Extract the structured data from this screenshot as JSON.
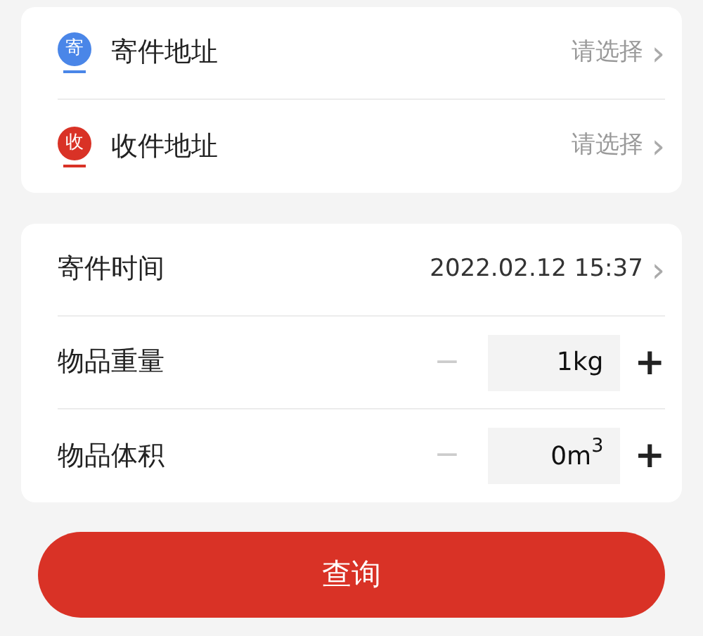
{
  "addresses": [
    {
      "badge": "寄",
      "color": "#4a86e8",
      "label": "寄件地址",
      "placeholder": "请选择",
      "chevron": "›"
    },
    {
      "badge": "收",
      "color": "#d93226",
      "label": "收件地址",
      "placeholder": "请选择",
      "chevron": "›"
    }
  ],
  "details": [
    {
      "kind": "picker",
      "label": "寄件时间",
      "value": "2022.02.12 15:37",
      "chevron": "›"
    },
    {
      "kind": "stepper",
      "label": "物品重量",
      "minus": "−",
      "value": "1kg",
      "plus": "+",
      "minus_disabled": true
    },
    {
      "kind": "stepper",
      "label": "物品体积",
      "minus": "−",
      "value": "0m$^{3}$",
      "plus": "+",
      "minus_disabled": true
    }
  ],
  "submit": "查询"
}
